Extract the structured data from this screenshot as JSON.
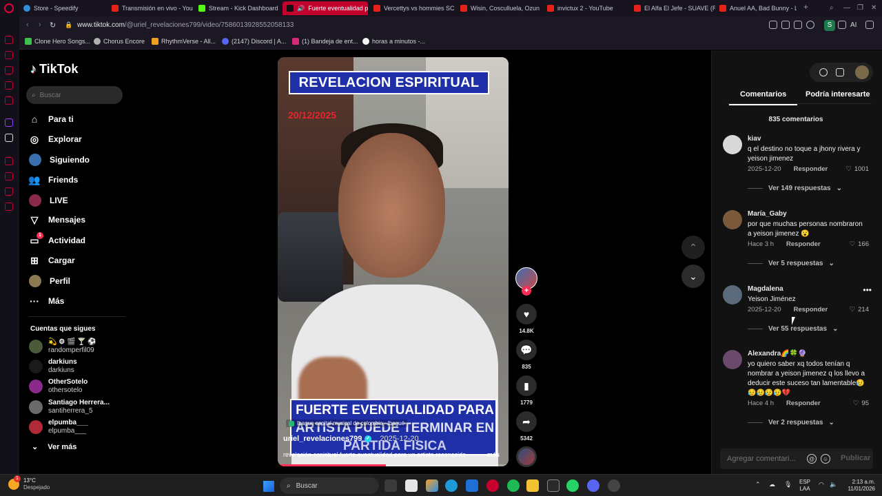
{
  "browser": {
    "tabs": [
      {
        "label": "Store - Speedify",
        "color": "#2f8fd8",
        "active": false
      },
      {
        "label": "Transmisión en vivo - You",
        "color": "#e62117",
        "active": false
      },
      {
        "label": "Stream - Kick Dashboard",
        "color": "#53fc18",
        "active": false
      },
      {
        "label": "Fuerte eventualidad p",
        "color": "#ffffff",
        "active": true
      },
      {
        "label": "Vercettys vs hommies SC",
        "color": "#e62117",
        "active": false
      },
      {
        "label": "Wisin, Cosculluela, Ozun",
        "color": "#e62117",
        "active": false
      },
      {
        "label": "invictux 2 - YouTube",
        "color": "#e62117",
        "active": false
      },
      {
        "label": "El Alfa El Jefe - SUAVE (R",
        "color": "#e62117",
        "active": false
      },
      {
        "label": "Anuel AA, Bad Bunny - La",
        "color": "#e62117",
        "active": false
      }
    ],
    "new_tab": "+",
    "url_host": "www.tiktok.com",
    "url_path": "/@uriel_revelaciones799/video/7586013928552058133",
    "profile_letter": "S",
    "ai_label": "AI",
    "bookmarks": [
      {
        "label": "Clone Hero Songs...",
        "color": "#3fbf4f"
      },
      {
        "label": "Chorus Encore",
        "color": "#b0b0b0"
      },
      {
        "label": "RhythmVerse - All...",
        "color": "#f0a020"
      },
      {
        "label": "(2147) Discord | A...",
        "color": "#5865f2"
      },
      {
        "label": "(1) Bandeja de ent...",
        "color": "#d62976"
      },
      {
        "label": "horas a minutos -...",
        "color": "#f4f4f4"
      }
    ]
  },
  "tiktok": {
    "logo": "TikTok",
    "search_placeholder": "Buscar",
    "nav": [
      {
        "label": "Para ti",
        "icon": "home-icon"
      },
      {
        "label": "Explorar",
        "icon": "compass-icon"
      },
      {
        "label": "Siguiendo",
        "icon": "following-avatar-icon"
      },
      {
        "label": "Friends",
        "icon": "friends-icon"
      },
      {
        "label": "LIVE",
        "icon": "live-avatar-icon"
      },
      {
        "label": "Mensajes",
        "icon": "send-icon"
      },
      {
        "label": "Actividad",
        "icon": "activity-icon",
        "badge": "1"
      },
      {
        "label": "Cargar",
        "icon": "upload-plus-icon"
      },
      {
        "label": "Perfil",
        "icon": "profile-avatar-icon"
      },
      {
        "label": "Más",
        "icon": "more-dots-icon"
      }
    ],
    "following_title": "Cuentas que sigues",
    "following": [
      {
        "name": "💫 ⚙ 🎬 🍸 ⚽",
        "handle": "randomperfil09"
      },
      {
        "name": "darkiuns",
        "handle": "darkiuns"
      },
      {
        "name": "OtherSotelo",
        "handle": "othersotelo"
      },
      {
        "name": "Santiago Herrera...",
        "handle": "santiherrera_5"
      },
      {
        "name": "elpumba___",
        "handle": "elpumba___"
      }
    ],
    "see_more": "Ver más"
  },
  "video": {
    "overlay_title": "REVELACION ESPIRITUAL",
    "overlay_date": "20/12/2025",
    "subtitle_lines": [
      "FUERTE EVENTUALIDAD PARA",
      "ARTISTA PUEDE TERMINAR EN",
      "PARTIDA FISICA"
    ],
    "location": "Ibague capital musical de colombia · Ibagué",
    "author": "uriel_revelaciones799",
    "date": "2025-12-20",
    "description": "revelación espiritual fuerte eventualidad para un artista reconocido",
    "more_label": "más",
    "progress": 0.47
  },
  "actions": {
    "likes": "14.8K",
    "comments": "835",
    "saves": "1779",
    "shares": "5342"
  },
  "comments_panel": {
    "tab_comments": "Comentarios",
    "tab_interest": "Podría interesarte",
    "count": "835 comentarios",
    "reply_label": "Responder",
    "items": [
      {
        "user": "kiav",
        "text": "q el destino no toque a jhony rivera y yeison jimenez",
        "time": "2025-12-20",
        "likes": "1001",
        "replies": "Ver 149 respuestas"
      },
      {
        "user": "María_Gaby",
        "text": "por que muchas personas nombraron a yeison jimenez 😮",
        "time": "Hace 3 h",
        "likes": "166",
        "replies": "Ver 5 respuestas"
      },
      {
        "user": "Magdalena",
        "text": "Yeison Jiménez",
        "time": "2025-12-20",
        "likes": "214",
        "replies": "Ver 55 respuestas"
      },
      {
        "user": "Alexandra🌈🍀🔮",
        "text": "yo quiero saber xq todos tenían q nombrar a yeison jimenez q los llevo a deducir este suceso tan lamentable😥😥😥😥😥💔",
        "time": "Hace 4 h",
        "likes": "95",
        "replies": "Ver 2 respuestas"
      }
    ],
    "composer_placeholder": "Agregar comentari...",
    "publish": "Publicar"
  },
  "taskbar": {
    "temp": "13°C",
    "weather": "Despejado",
    "weather_badge": "1",
    "search": "Buscar",
    "lang_line1": "ESP",
    "lang_line2": "LAA",
    "time": "2:13 a.m.",
    "date": "11/01/2026"
  }
}
